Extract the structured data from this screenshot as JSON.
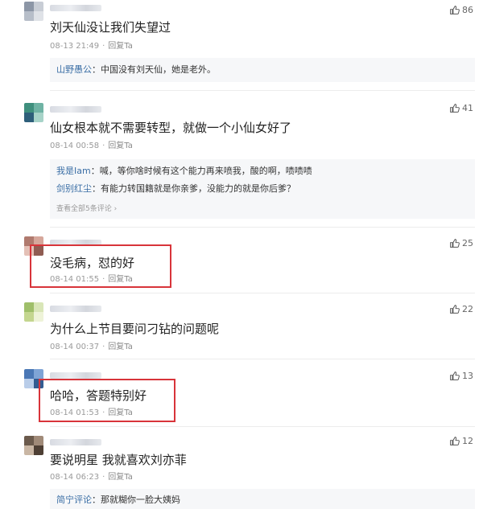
{
  "comments": [
    {
      "text": "刘天仙没让我们失望过",
      "time": "08-13 21:49",
      "reply_label": "回复Ta",
      "likes": "86",
      "replies": [
        {
          "name": "山野愚公",
          "text": "：中国没有刘天仙，她是老外。"
        }
      ],
      "avatar_colors": [
        "#8c96a6",
        "#c8cdd5",
        "#b7bec9",
        "#dfe2e7"
      ]
    },
    {
      "text": "仙女根本就不需要转型，就做一个小仙女好了",
      "time": "08-14 00:58",
      "reply_label": "回复Ta",
      "likes": "41",
      "replies": [
        {
          "name": "我是Iam",
          "text": "：喊，等你啥时候有这个能力再来喷我，酸的啊，啧啧啧"
        },
        {
          "name": "剑别红尘",
          "text": "：有能力转国籍就是你亲爹，没能力的就是你后爹？"
        }
      ],
      "more_text": "查看全部5条评论 ›",
      "avatar_colors": [
        "#3f8f7d",
        "#6fb3a4",
        "#2e5f7a",
        "#a7d3c8"
      ]
    },
    {
      "text": "没毛病，怼的好",
      "time": "08-14 01:55",
      "reply_label": "回复Ta",
      "likes": "25",
      "avatar_colors": [
        "#b07a6e",
        "#d6a79b",
        "#e4c0b6",
        "#8f5c52"
      ]
    },
    {
      "text": "为什么上节目要问刁钻的问题呢",
      "time": "08-14 00:37",
      "reply_label": "回复Ta",
      "likes": "22",
      "avatar_colors": [
        "#9fbf6a",
        "#d9e6b8",
        "#c4d68f",
        "#eef3d8"
      ]
    },
    {
      "text": "哈哈，答题特别好",
      "time": "08-14 01:53",
      "reply_label": "回复Ta",
      "likes": "13",
      "avatar_colors": [
        "#4a77b5",
        "#7fa4d6",
        "#b9cde9",
        "#335c91"
      ]
    },
    {
      "text": "要说明星 我就喜欢刘亦菲",
      "time": "08-14 06:23",
      "reply_label": "回复Ta",
      "likes": "12",
      "replies": [
        {
          "name": "简宁评论",
          "text": "：那就糊你一脸大姨妈"
        }
      ],
      "avatar_colors": [
        "#6b5a4c",
        "#a08a78",
        "#c9b6a4",
        "#4e3f34"
      ]
    }
  ],
  "colors": {
    "highlight_box": "#d8343a",
    "reply_name": "#3a6ea5",
    "reply_bg": "#f6f7f9"
  },
  "icons": {
    "like": "thumbs-up-icon"
  }
}
